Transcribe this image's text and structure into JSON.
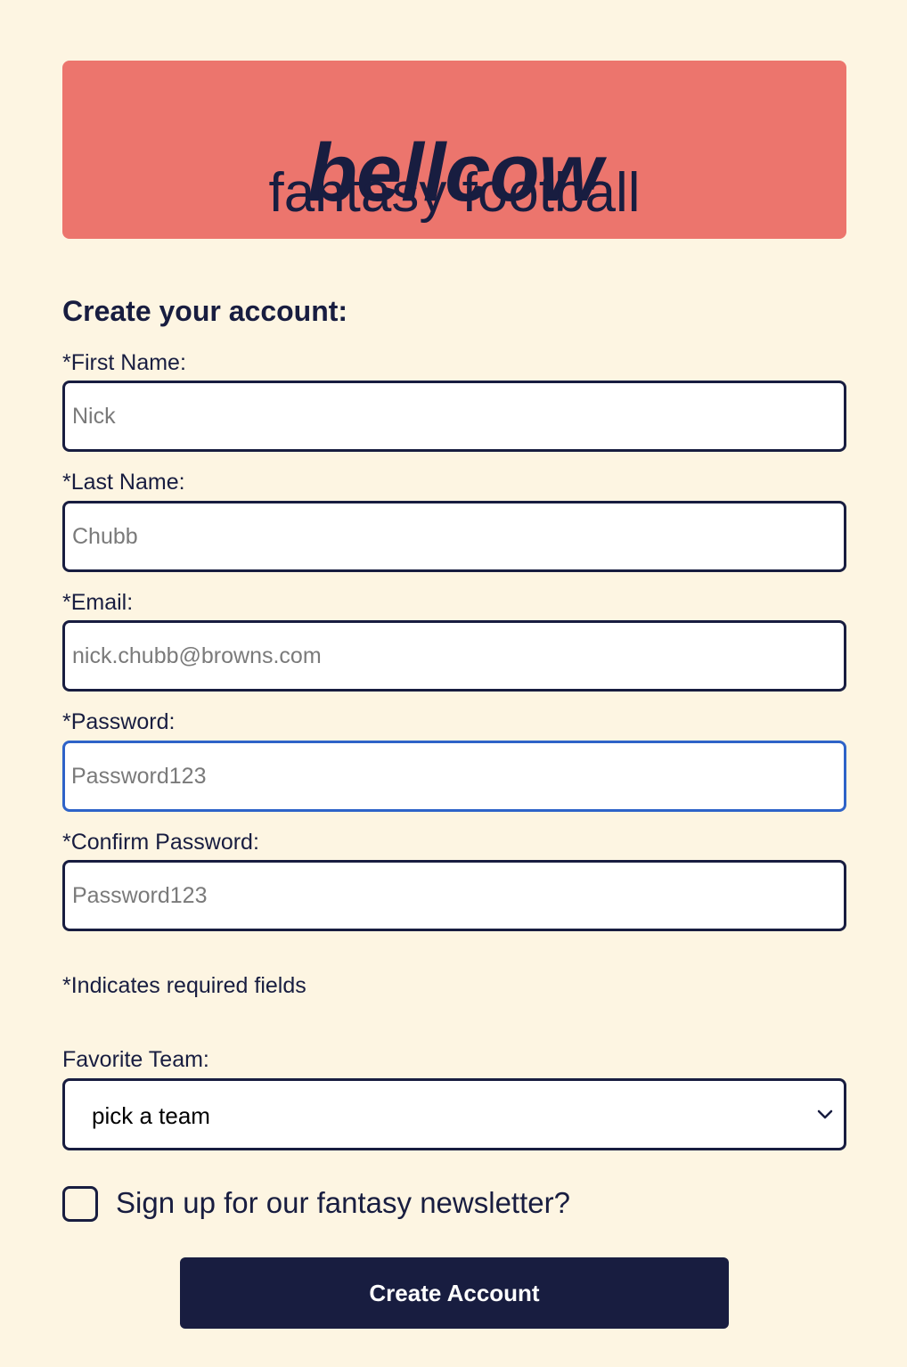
{
  "header": {
    "brand": "bellcow",
    "tagline": "fantasy football"
  },
  "form": {
    "heading": "Create your account:",
    "fields": [
      {
        "label": "*First Name:",
        "placeholder": "Nick"
      },
      {
        "label": "*Last Name:",
        "placeholder": "Chubb"
      },
      {
        "label": "*Email:",
        "placeholder": "nick.chubb@browns.com"
      },
      {
        "label": "*Password:",
        "placeholder": "Password123"
      },
      {
        "label": "*Confirm Password:",
        "placeholder": "Password123"
      }
    ],
    "required_note": "*Indicates required fields",
    "favorite_team": {
      "label": "Favorite Team:",
      "selected": "pick a team"
    },
    "newsletter": {
      "label": "Sign up for our fantasy newsletter?",
      "checked": false
    },
    "submit_label": "Create Account"
  },
  "colors": {
    "background": "#fdf5e2",
    "banner": "#ec756d",
    "navy": "#181d40",
    "focus_border": "#2e63c8"
  }
}
